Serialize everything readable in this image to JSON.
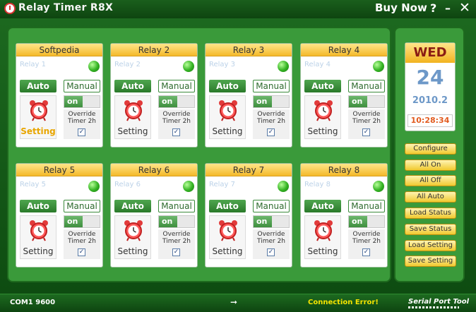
{
  "app": {
    "title": "Relay Timer R8X",
    "buy_now": "Buy Now",
    "help_glyph": "?",
    "minimize_glyph": "–",
    "close_glyph": "✕"
  },
  "relays": [
    {
      "header": "Softpedia",
      "name": "Relay 1",
      "auto": "Auto",
      "manual": "Manual",
      "toggle": "on",
      "override": "Override Timer 2h",
      "setting": "Setting"
    },
    {
      "header": "Relay 2",
      "name": "Relay 2",
      "auto": "Auto",
      "manual": "Manual",
      "toggle": "on",
      "override": "Override Timer 2h",
      "setting": "Setting"
    },
    {
      "header": "Relay 3",
      "name": "Relay 3",
      "auto": "Auto",
      "manual": "Manual",
      "toggle": "on",
      "override": "Override Timer 2h",
      "setting": "Setting"
    },
    {
      "header": "Relay 4",
      "name": "Relay 4",
      "auto": "Auto",
      "manual": "Manual",
      "toggle": "on",
      "override": "Override Timer 2h",
      "setting": "Setting"
    },
    {
      "header": "Relay 5",
      "name": "Relay 5",
      "auto": "Auto",
      "manual": "Manual",
      "toggle": "on",
      "override": "Override Timer 2h",
      "setting": "Setting"
    },
    {
      "header": "Relay 6",
      "name": "Relay 6",
      "auto": "Auto",
      "manual": "Manual",
      "toggle": "on",
      "override": "Override Timer 2h",
      "setting": "Setting"
    },
    {
      "header": "Relay 7",
      "name": "Relay 7",
      "auto": "Auto",
      "manual": "Manual",
      "toggle": "on",
      "override": "Override Timer 2h",
      "setting": "Setting"
    },
    {
      "header": "Relay 8",
      "name": "Relay 8",
      "auto": "Auto",
      "manual": "Manual",
      "toggle": "on",
      "override": "Override Timer 2h",
      "setting": "Setting"
    }
  ],
  "calendar": {
    "day": "WED",
    "date": "24",
    "year_month": "2010.2",
    "time": "10:28:34"
  },
  "side_buttons": [
    "Configure",
    "All On",
    "All Off",
    "All Auto",
    "Load Status",
    "Save Status",
    "Load Setting",
    "Save Setting"
  ],
  "status": {
    "port": "COM1 9600",
    "arrow": "➞",
    "error": "Connection Error!",
    "brand": "Serial Port Tool"
  },
  "colors": {
    "frame_green": "#1d6a20",
    "panel_green": "#3a9a3a",
    "header_gold": "#f4b92a",
    "led_green": "#33b322",
    "error_yellow": "#f5e400",
    "time_orange": "#e25b1f"
  }
}
